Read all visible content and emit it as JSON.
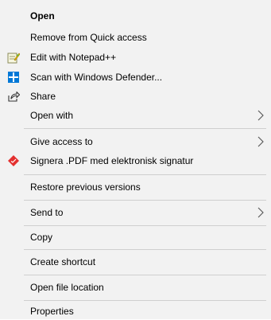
{
  "context_menu": {
    "items": [
      {
        "label": "Open"
      },
      {
        "label": "Remove from Quick access"
      },
      {
        "label": "Edit with Notepad++",
        "icon": "notepad-plus-plus-icon"
      },
      {
        "label": "Scan with Windows Defender...",
        "icon": "windows-defender-icon"
      },
      {
        "label": "Share",
        "icon": "share-icon"
      },
      {
        "label": "Open with"
      },
      {
        "label": "Give access to"
      },
      {
        "label": "Signera .PDF med elektronisk signatur",
        "icon": "signera-icon"
      },
      {
        "label": "Restore previous versions"
      },
      {
        "label": "Send to"
      },
      {
        "label": "Copy"
      },
      {
        "label": "Create shortcut"
      },
      {
        "label": "Open file location"
      },
      {
        "label": "Properties"
      }
    ],
    "colors": {
      "background": "#f2f2f2",
      "separator": "#cfcfcf",
      "defender_blue": "#0078d7",
      "signera_red": "#e3302f"
    }
  }
}
